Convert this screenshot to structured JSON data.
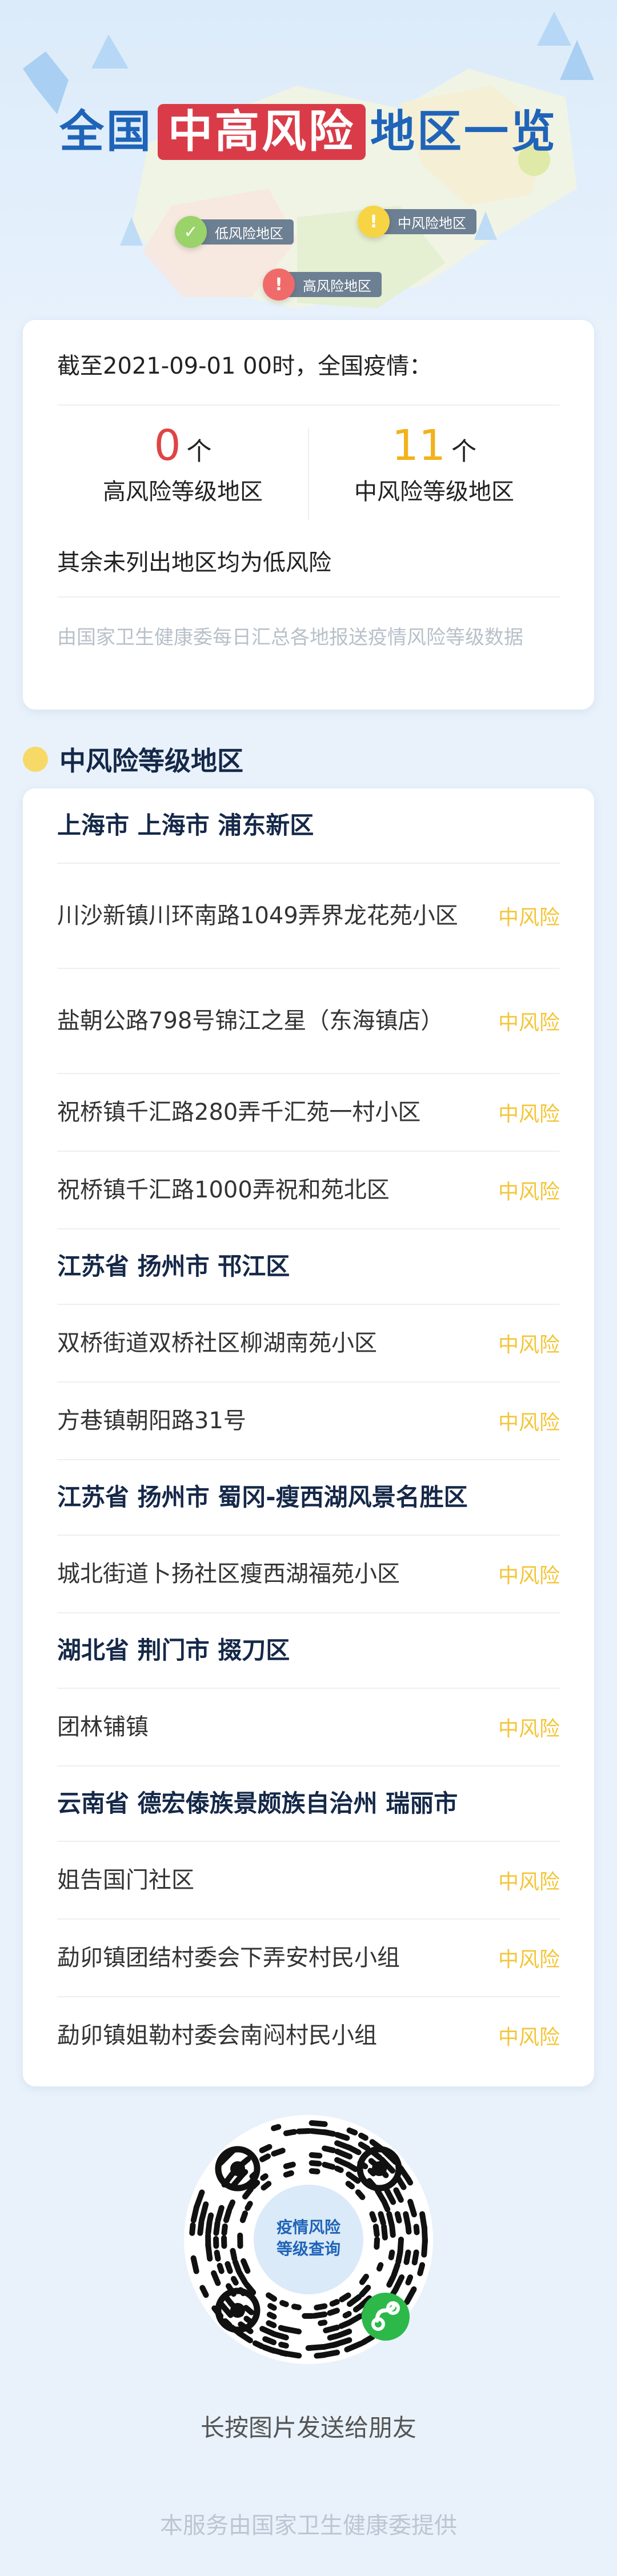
{
  "header": {
    "title_pre": "全国",
    "title_hl": "中高风险",
    "title_post": "地区一览",
    "tags": {
      "low": "低风险地区",
      "mid": "中风险地区",
      "high": "高风险地区"
    },
    "colors": {
      "low": "#9ad36a",
      "mid": "#f7d444",
      "high": "#f06a6a"
    }
  },
  "summary": {
    "cutoff": "截至2021-09-01 00时，全国疫情：",
    "high": {
      "num": "0",
      "unit": "个",
      "label": "高风险等级地区"
    },
    "mid": {
      "num": "11",
      "unit": "个",
      "label": "中风险等级地区"
    },
    "note": "其余未列出地区均为低风险",
    "source": "由国家卫生健康委每日汇总各地报送疫情风险等级数据"
  },
  "section": {
    "title": "中风险等级地区"
  },
  "list": [
    {
      "type": "head",
      "text": "上海市 上海市 浦东新区"
    },
    {
      "type": "item",
      "text": "川沙新镇川环南路1049弄界龙花苑小区",
      "badge": "中风险"
    },
    {
      "type": "item",
      "text": "盐朝公路798号锦江之星（东海镇店）",
      "badge": "中风险"
    },
    {
      "type": "item",
      "text": "祝桥镇千汇路280弄千汇苑一村小区",
      "badge": "中风险"
    },
    {
      "type": "item",
      "text": "祝桥镇千汇路1000弄祝和苑北区",
      "badge": "中风险"
    },
    {
      "type": "head",
      "text": "江苏省 扬州市 邗江区"
    },
    {
      "type": "item",
      "text": "双桥街道双桥社区柳湖南苑小区",
      "badge": "中风险"
    },
    {
      "type": "item",
      "text": "方巷镇朝阳路31号",
      "badge": "中风险"
    },
    {
      "type": "head",
      "text": "江苏省 扬州市 蜀冈-瘦西湖风景名胜区"
    },
    {
      "type": "item",
      "text": "城北街道卜扬社区瘦西湖福苑小区",
      "badge": "中风险"
    },
    {
      "type": "head",
      "text": "湖北省 荆门市 掇刀区"
    },
    {
      "type": "item",
      "text": "团林铺镇",
      "badge": "中风险"
    },
    {
      "type": "head",
      "text": "云南省 德宏傣族景颇族自治州 瑞丽市"
    },
    {
      "type": "item",
      "text": "姐告国门社区",
      "badge": "中风险"
    },
    {
      "type": "item",
      "text": "勐卯镇团结村委会下弄安村民小组",
      "badge": "中风险"
    },
    {
      "type": "item",
      "text": "勐卯镇姐勒村委会南闷村民小组",
      "badge": "中风险"
    }
  ],
  "qr": {
    "center_line1": "疫情风险",
    "center_line2": "等级查询"
  },
  "footer": {
    "share": "长按图片发送给朋友",
    "provider": "本服务由国家卫生健康委提供"
  }
}
